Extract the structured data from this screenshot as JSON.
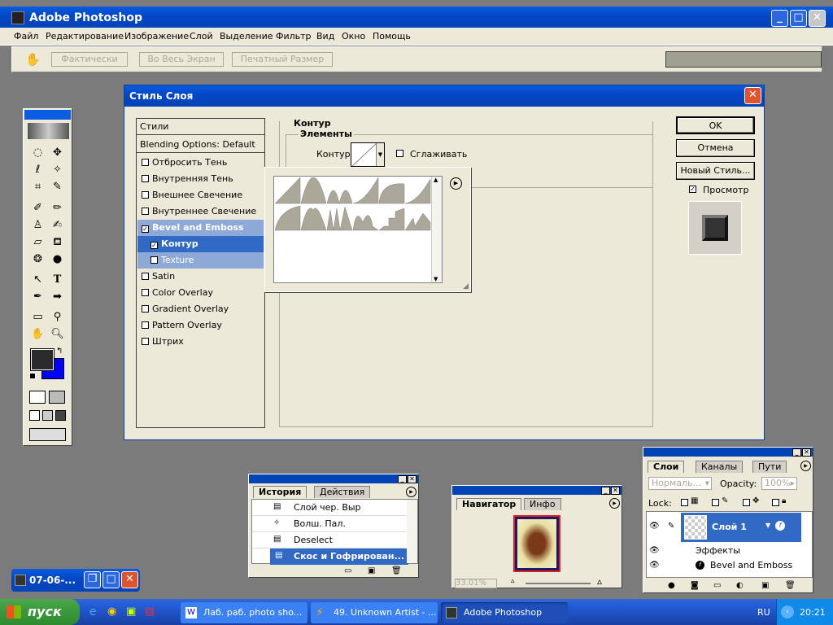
{
  "app": {
    "title": "Adobe Photoshop"
  },
  "menu": [
    "Файл",
    "Редактирование",
    "Изображение",
    "Слой",
    "Выделение",
    "Фильтр",
    "Вид",
    "Окно",
    "Помощь"
  ],
  "options": {
    "btn1": "Фактически",
    "btn2": "Во Весь Экран",
    "btn3": "Печатный Размер"
  },
  "dialog": {
    "title": "Стиль Слоя",
    "styles_header": "Стили",
    "blending": "Blending Options: Default",
    "items": [
      {
        "label": "Отбросить Тень",
        "checked": false
      },
      {
        "label": "Внутренняя Тень",
        "checked": false
      },
      {
        "label": "Внешнее Свечение",
        "checked": false
      },
      {
        "label": "Внутреннее Свечение",
        "checked": false
      },
      {
        "label": "Bevel and Emboss",
        "checked": true
      },
      {
        "label": "Контур",
        "checked": true
      },
      {
        "label": "Texture",
        "checked": false
      },
      {
        "label": "Satin",
        "checked": false
      },
      {
        "label": "Color Overlay",
        "checked": false
      },
      {
        "label": "Gradient Overlay",
        "checked": false
      },
      {
        "label": "Pattern Overlay",
        "checked": false
      },
      {
        "label": "Штрих",
        "checked": false
      }
    ],
    "section_title": "Контур",
    "group_title": "Элементы",
    "contour_label": "Контур:",
    "smooth_label": "Сглаживать",
    "ok": "OK",
    "cancel": "Отмена",
    "new_style": "Новый Стиль...",
    "preview_label": "Просмотр",
    "preview_checked": true
  },
  "history": {
    "tabs": [
      "История",
      "Действия"
    ],
    "items": [
      "Слой чер. Выр",
      "Волш. Пал.",
      "Deselect",
      "Скос и Гофрирован..."
    ],
    "selected": 3
  },
  "navigator": {
    "tabs": [
      "Навигатор",
      "Инфо"
    ],
    "zoom": "33.01%"
  },
  "layers": {
    "tabs": [
      "Слои",
      "Каналы",
      "Пути"
    ],
    "blend_mode": "Нормаль...",
    "opacity_label": "Opacity:",
    "opacity": "100%",
    "lock_label": "Lock:",
    "layer_name": "Слой 1",
    "effects_label": "Эффекты",
    "effect_item": "Bevel and Emboss"
  },
  "minimized": {
    "title": "07-06-..."
  },
  "taskbar": {
    "start": "пуск",
    "tasks": [
      "Лаб. раб. photo sho...",
      "49. Unknown Artist - ...",
      "Adobe Photoshop"
    ],
    "lang": "RU",
    "time": "20:21"
  },
  "colors": {
    "xp_blue": "#0243b6",
    "selection": "#316ac5",
    "panel_bg": "#ece9d8",
    "workspace": "#7b7b7b",
    "start_green": "#3c9a3c",
    "bg_color_swatch": "#0000ff",
    "fg_color_swatch": "#2a2a2a"
  }
}
